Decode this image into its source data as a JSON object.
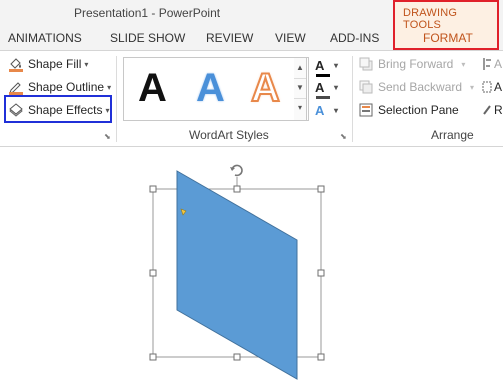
{
  "window": {
    "title": "Presentation1 - PowerPoint"
  },
  "contextual_tab": {
    "group_label": "DRAWING TOOLS",
    "tab_label": "FORMAT"
  },
  "tabs": [
    {
      "label": "ANIMATIONS"
    },
    {
      "label": "SLIDE SHOW"
    },
    {
      "label": "REVIEW"
    },
    {
      "label": "VIEW"
    },
    {
      "label": "ADD-INS"
    }
  ],
  "shape_styles": {
    "fill": "Shape Fill",
    "outline": "Shape Outline",
    "effects": "Shape Effects"
  },
  "wordart": {
    "samples": [
      "A",
      "A",
      "A"
    ],
    "group_label": "WordArt Styles",
    "text_fill_color": "#000000",
    "text_outline_color": "#4a4a4a",
    "text_effects_color": "#4a90d9"
  },
  "arrange": {
    "bring_forward": "Bring Forward",
    "send_backward": "Send Backward",
    "selection_pane": "Selection Pane",
    "group_label": "Arrange",
    "cut_off_1": "A",
    "cut_off_2": "A",
    "cut_off_3": "R"
  },
  "colors": {
    "accent_red": "#e0202a",
    "accent_blue": "#2030d8",
    "contextual_text": "#c0541c",
    "shape_fill": "#5b9bd5"
  }
}
